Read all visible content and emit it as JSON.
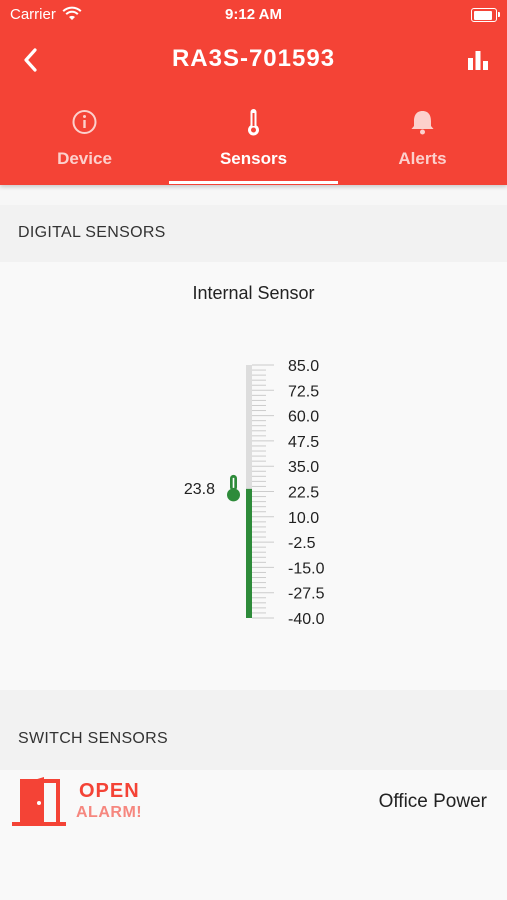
{
  "status_bar": {
    "carrier": "Carrier",
    "time": "9:12 AM"
  },
  "header": {
    "title": "RA3S-701593"
  },
  "tabs": [
    {
      "label": "Device",
      "icon": "info-icon",
      "active": false
    },
    {
      "label": "Sensors",
      "icon": "thermometer-icon",
      "active": true
    },
    {
      "label": "Alerts",
      "icon": "bell-icon",
      "active": false
    }
  ],
  "digital_sensors": {
    "heading": "DIGITAL SENSORS",
    "sensor": {
      "name": "Internal Sensor",
      "value_label": "23.8",
      "value": 23.8,
      "scale": {
        "min": -40.0,
        "max": 85.0
      },
      "ticks": [
        "85.0",
        "72.5",
        "60.0",
        "47.5",
        "35.0",
        "22.5",
        "10.0",
        "-2.5",
        "-15.0",
        "-27.5",
        "-40.0"
      ]
    }
  },
  "switch_sensors": {
    "heading": "SWITCH SENSORS",
    "item": {
      "state": "OPEN",
      "alarm": "ALARM!",
      "name": "Office Power"
    }
  },
  "colors": {
    "accent": "#f44336",
    "gauge_fill": "#2e8b3a",
    "gauge_track": "#dddddd"
  }
}
